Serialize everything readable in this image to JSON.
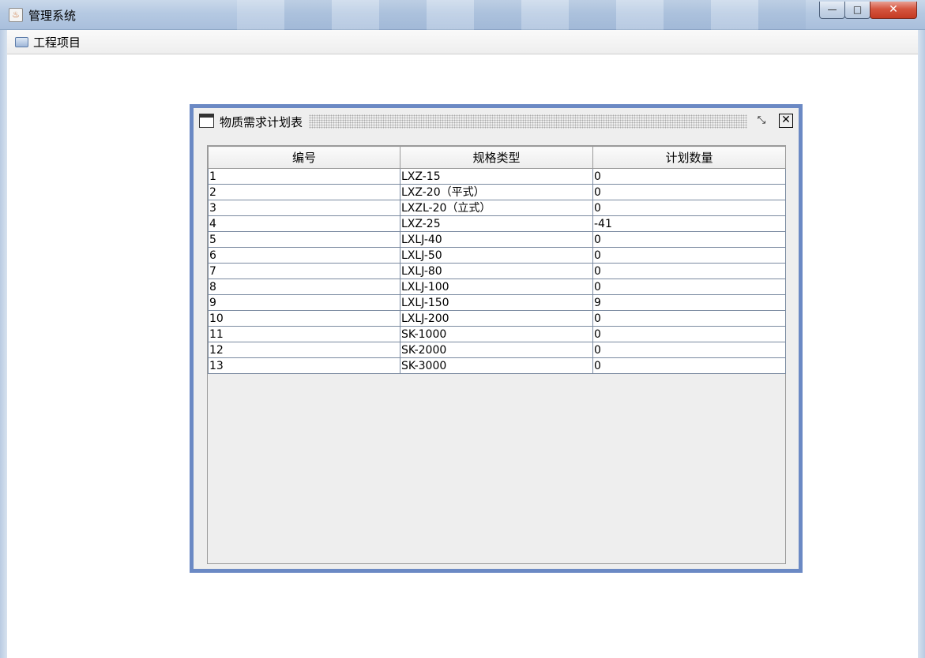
{
  "window": {
    "title": "管理系统",
    "min_label": "—",
    "max_label": "□",
    "close_label": "✕"
  },
  "menubar": {
    "project_label": "工程项目"
  },
  "internal_frame": {
    "title": "物质需求计划表",
    "iconify_label": "⤡",
    "close_label": "✕"
  },
  "table": {
    "headers": [
      "编号",
      "规格类型",
      "计划数量"
    ],
    "rows": [
      [
        "1",
        "LXZ-15",
        "0"
      ],
      [
        "2",
        "LXZ-20（平式）",
        "0"
      ],
      [
        "3",
        "LXZL-20（立式）",
        "0"
      ],
      [
        "4",
        "LXZ-25",
        "-41"
      ],
      [
        "5",
        "LXLJ-40",
        "0"
      ],
      [
        "6",
        "LXLJ-50",
        "0"
      ],
      [
        "7",
        "LXLJ-80",
        "0"
      ],
      [
        "8",
        "LXLJ-100",
        "0"
      ],
      [
        "9",
        "LXLJ-150",
        "9"
      ],
      [
        "10",
        "LXLJ-200",
        "0"
      ],
      [
        "11",
        "SK-1000",
        "0"
      ],
      [
        "12",
        "SK-2000",
        "0"
      ],
      [
        "13",
        "SK-3000",
        "0"
      ]
    ]
  },
  "colors": {
    "frame_border": "#6b89c4",
    "titlebar": "#b5c9e2",
    "close_button": "#c43a22"
  }
}
